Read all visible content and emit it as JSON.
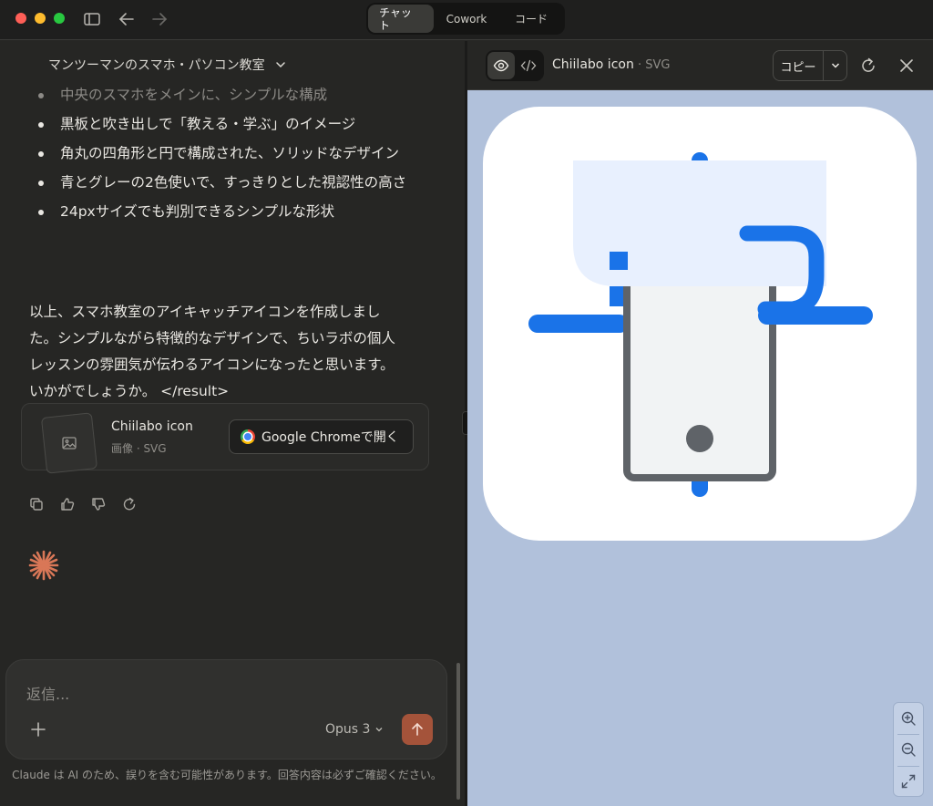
{
  "titlebar": {
    "modes": [
      {
        "label": "チャット",
        "active": true
      },
      {
        "label": "Cowork",
        "active": false
      },
      {
        "label": "コード",
        "active": false
      }
    ]
  },
  "chat": {
    "conversation_title": "マンツーマンのスマホ・パソコン教室",
    "bullets": [
      "中央のスマホをメインに、シンプルな構成",
      "黒板と吹き出しで「教える・学ぶ」のイメージ",
      "角丸の四角形と円で構成された、ソリッドなデザイン",
      "青とグレーの2色使いで、すっきりとした視認性の高さ",
      "24pxサイズでも判別できるシンプルな形状"
    ],
    "paragraph": "以上、スマホ教室のアイキャッチアイコンを作成しました。シンプルながら特徴的なデザインで、ちいラボの個人レッスンの雰囲気が伝わるアイコンになったと思います。いかがでしょうか。 </result>",
    "artifact_card": {
      "title": "Chiilabo icon",
      "subtitle": "画像 · SVG",
      "open_button": "Google Chromeで開く"
    },
    "action_icons": [
      "copy-icon",
      "thumbs-up-icon",
      "thumbs-down-icon",
      "retry-icon"
    ],
    "composer": {
      "placeholder": "返信...",
      "model": "Opus 3"
    },
    "disclaimer": "Claude は AI のため、誤りを含む可能性があります。回答内容は必ずご確認ください。"
  },
  "artifact_panel": {
    "title": "Chiilabo icon",
    "type": "SVG",
    "copy_label": "コピー"
  },
  "colors": {
    "accent_blue": "#1a73e8",
    "phone_gray": "#5f6368",
    "board_tint": "#e8f0fe",
    "send_button": "#a4533a",
    "preview_bg": "#b1c1db"
  }
}
